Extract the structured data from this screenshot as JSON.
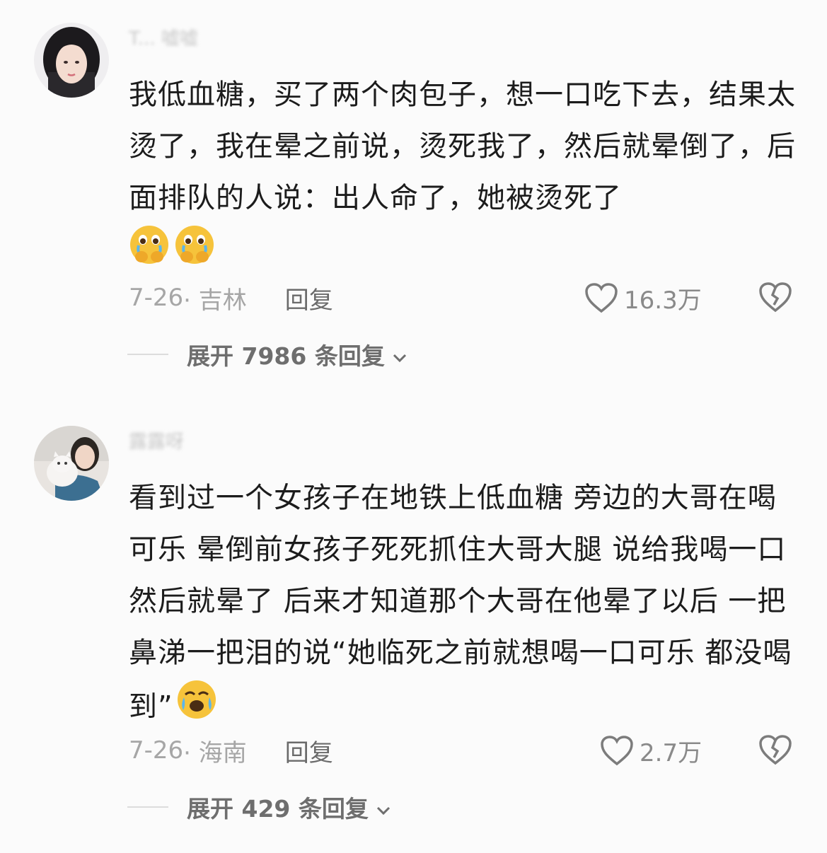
{
  "comments": [
    {
      "username": "T... 嘘嘘",
      "text": "我低血糖，买了两个肉包子，想一口吃下去，结果太烫了，我在晕之前说，烫死我了，然后就晕倒了，后面排队的人说：出人命了，她被烫死了",
      "emojis": [
        "hand-over-mouth-crying-emoji",
        "hand-over-mouth-crying-emoji"
      ],
      "date": "7-26",
      "location": "· 吉林",
      "reply_label": "回复",
      "likes": "16.3万",
      "expand_label": "展开 7986 条回复"
    },
    {
      "username": "露露呀",
      "text": "看到过一个女孩子在地铁上低血糖 旁边的大哥在喝可乐 晕倒前女孩子死死抓住大哥大腿 说给我喝一口 然后就晕了 后来才知道那个大哥在他晕了以后 一把鼻涕一把泪的说“她临死之前就想喝一口可乐 都没喝到”",
      "emojis": [
        "crying-face-emoji"
      ],
      "date": "7-26",
      "location": "· 海南",
      "reply_label": "回复",
      "likes": "2.7万",
      "expand_label": "展开 429 条回复"
    }
  ],
  "colors": {
    "background": "#fbfbfb",
    "text": "#1c1c1c",
    "meta": "#a6a6a6",
    "emoji_yellow": "#f6c33b"
  }
}
